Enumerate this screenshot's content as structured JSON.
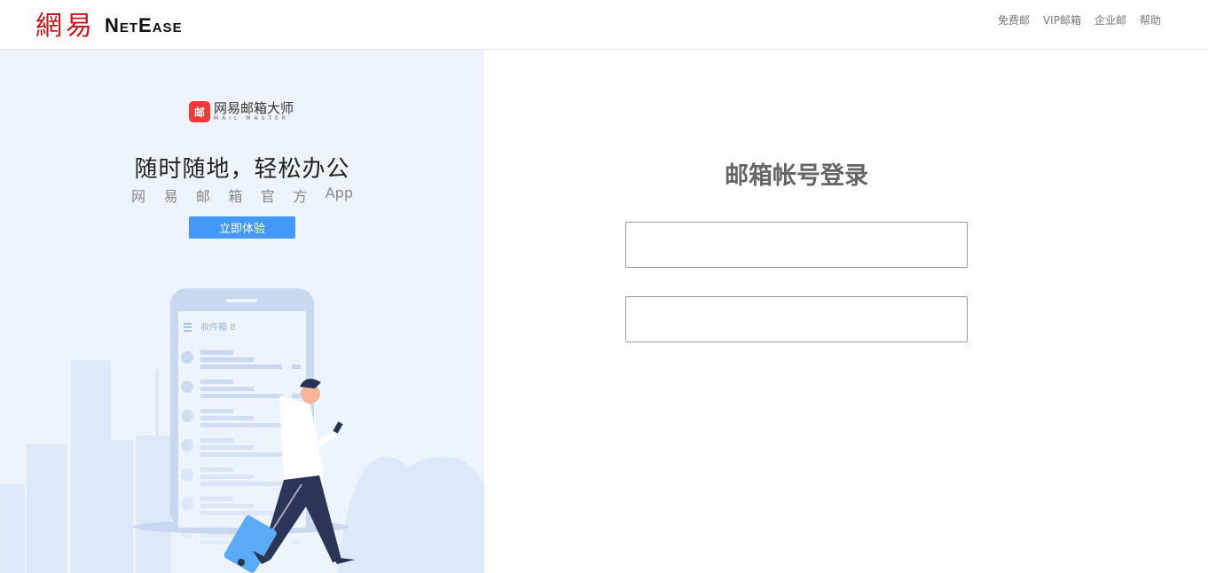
{
  "header": {
    "logo_cn": "網易",
    "logo_en": "NetEase",
    "nav": [
      "免费邮",
      "VIP邮箱",
      "企业邮",
      "帮助"
    ]
  },
  "promo": {
    "app_name_cn": "网易邮箱大师",
    "app_name_en": "MAIL MASTER",
    "app_icon_text": "邮",
    "slogan": "随时随地，轻松办公",
    "subtitle": [
      "网",
      "易",
      "邮",
      "箱",
      "官",
      "方",
      "App"
    ],
    "button": "立即体验",
    "inbox_label": "收件箱 8"
  },
  "login": {
    "title": "邮箱帐号登录",
    "account_value": "",
    "password_value": ""
  },
  "colors": {
    "accent": "#4499f7",
    "brand_red": "#c4161c",
    "panel_bg": "#eef4fe"
  }
}
